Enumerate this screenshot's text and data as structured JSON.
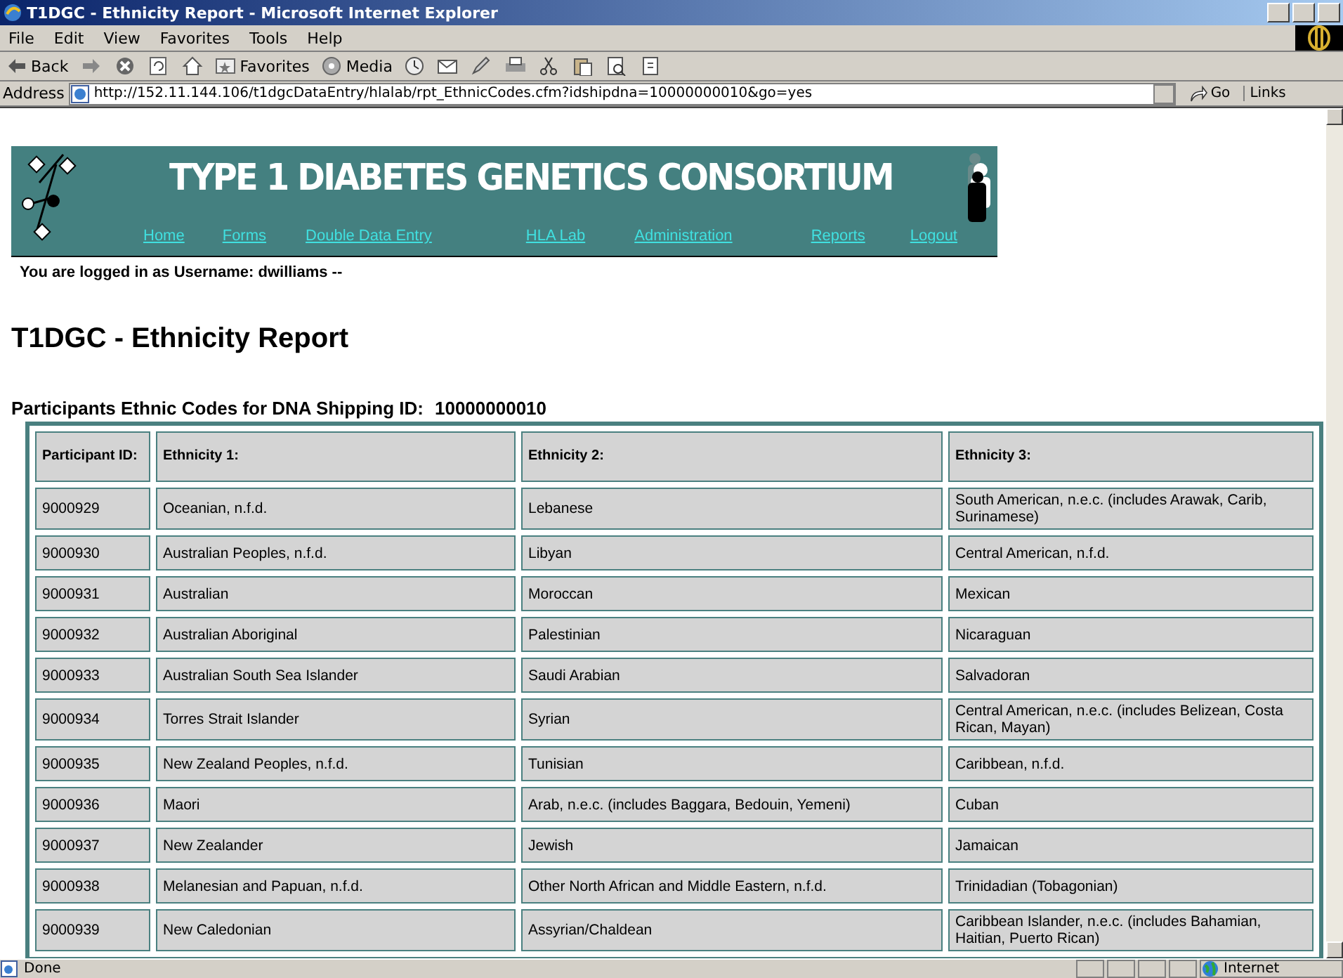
{
  "window": {
    "title": "T1DGC - Ethnicity Report - Microsoft Internet Explorer"
  },
  "menu": [
    "File",
    "Edit",
    "View",
    "Favorites",
    "Tools",
    "Help"
  ],
  "toolbar": [
    {
      "kind": "back",
      "label": "Back"
    },
    {
      "kind": "forward"
    },
    {
      "kind": "stop"
    },
    {
      "kind": "refresh"
    },
    {
      "kind": "home"
    },
    {
      "kind": "favorites",
      "label": "Favorites"
    },
    {
      "kind": "media",
      "label": "Media"
    },
    {
      "kind": "history"
    },
    {
      "kind": "mail"
    },
    {
      "kind": "edit"
    },
    {
      "kind": "print"
    },
    {
      "kind": "cut"
    },
    {
      "kind": "paste"
    },
    {
      "kind": "preview"
    },
    {
      "kind": "doc"
    }
  ],
  "address": {
    "label": "Address",
    "value": "http://152.11.144.106/t1dgcDataEntry/hlalab/rpt_EthnicCodes.cfm?idshipdna=10000000010&go=yes",
    "go": "Go",
    "links": "Links"
  },
  "banner": {
    "title": "TYPE 1 DIABETES GENETICS CONSORTIUM",
    "nav": [
      "Home",
      "Forms",
      "Double Data Entry",
      "HLA Lab",
      "Administration",
      "Reports",
      "Logout"
    ]
  },
  "login": "You are logged in as Username:  dwilliams --",
  "heading": "T1DGC - Ethnicity Report",
  "subtitle": {
    "label": "Participants Ethnic Codes for DNA Shipping ID:",
    "value": "10000000010"
  },
  "table": {
    "columns": [
      "Participant ID:",
      "Ethnicity 1:",
      "Ethnicity 2:",
      "Ethnicity 3:"
    ],
    "rows": [
      [
        "9000929",
        "Oceanian, n.f.d.",
        "Lebanese",
        "South American, n.e.c. (includes Arawak, Carib, Surinamese)"
      ],
      [
        "9000930",
        "Australian Peoples, n.f.d.",
        "Libyan",
        "Central American, n.f.d."
      ],
      [
        "9000931",
        "Australian",
        "Moroccan",
        "Mexican"
      ],
      [
        "9000932",
        "Australian Aboriginal",
        "Palestinian",
        "Nicaraguan"
      ],
      [
        "9000933",
        "Australian South Sea Islander",
        "Saudi Arabian",
        "Salvadoran"
      ],
      [
        "9000934",
        "Torres Strait Islander",
        "Syrian",
        "Central American, n.e.c. (includes Belizean, Costa Rican, Mayan)"
      ],
      [
        "9000935",
        "New Zealand Peoples, n.f.d.",
        "Tunisian",
        "Caribbean, n.f.d."
      ],
      [
        "9000936",
        "Maori",
        "Arab, n.e.c. (includes Baggara, Bedouin, Yemeni)",
        "Cuban"
      ],
      [
        "9000937",
        "New Zealander",
        "Jewish",
        "Jamaican"
      ],
      [
        "9000938",
        "Melanesian and Papuan, n.f.d.",
        "Other North African and Middle Eastern, n.f.d.",
        "Trinidadian (Tobagonian)"
      ],
      [
        "9000939",
        "New Caledonian",
        "Assyrian/Chaldean",
        "Caribbean Islander, n.e.c. (includes Bahamian, Haitian, Puerto Rican)"
      ]
    ]
  },
  "status_bar": {
    "text": "Done",
    "zone": "Internet"
  }
}
